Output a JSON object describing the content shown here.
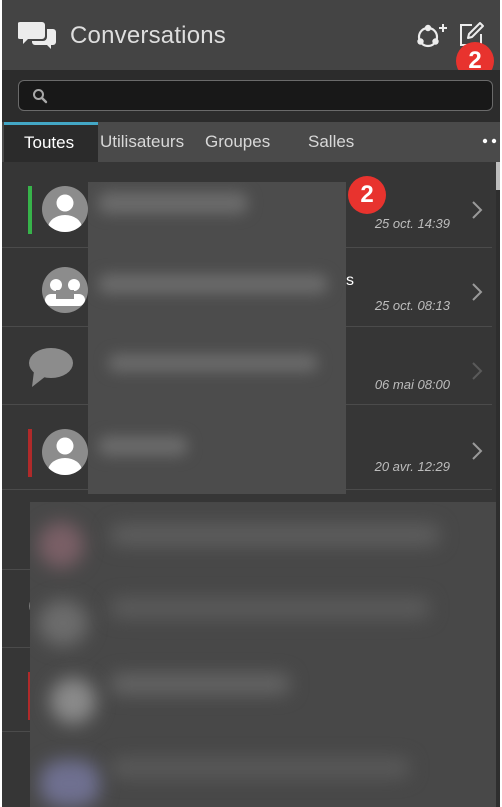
{
  "header": {
    "title": "Conversations",
    "notification_count": "2"
  },
  "search": {
    "placeholder": ""
  },
  "tabs": [
    {
      "label": "Toutes",
      "active": true
    },
    {
      "label": "Utilisateurs",
      "active": false
    },
    {
      "label": "Groupes",
      "active": false
    },
    {
      "label": "Salles",
      "active": false
    }
  ],
  "conversations": [
    {
      "avatar": "user-avatar",
      "status_color": "#37b34a",
      "time": "25 oct. 14:39",
      "unread": "2"
    },
    {
      "avatar": "group-avatar",
      "status_color": "",
      "time": "25 oct. 08:13",
      "snippet_tail": "s"
    },
    {
      "avatar": "chat-bubble-avatar",
      "status_color": "",
      "time": "06 mai 08:00"
    },
    {
      "avatar": "user-avatar",
      "status_color": "#b02a2a",
      "time": "20 avr. 12:29"
    }
  ],
  "colors": {
    "accent_tab": "#43a7c6",
    "badge": "#e8332e",
    "online": "#37b34a",
    "busy": "#b02a2a"
  }
}
